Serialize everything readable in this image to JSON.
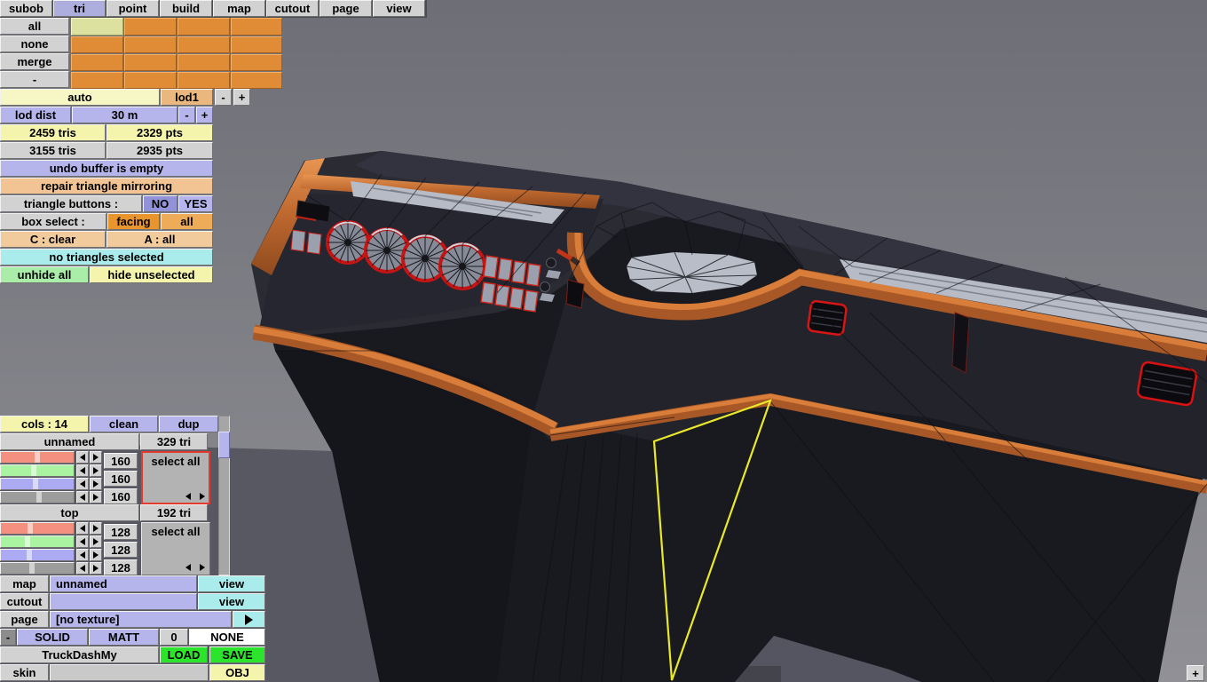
{
  "menu": {
    "tabs": [
      "subob",
      "tri",
      "point",
      "build",
      "map",
      "cutout",
      "page",
      "view"
    ],
    "active_tab": "tri"
  },
  "subob_panel": {
    "buttons": [
      "all",
      "none",
      "merge",
      "-"
    ]
  },
  "lod_bar": {
    "auto": "auto",
    "lod": "lod1",
    "minus": "-",
    "plus": "+"
  },
  "lod_dist": {
    "label": "lod dist",
    "value": "30 m",
    "minus": "-",
    "plus": "+"
  },
  "stats": {
    "lod_tris": "2459 tris",
    "lod_pts": "2329 pts",
    "model_tris": "3155 tris",
    "model_pts": "2935 pts"
  },
  "status": {
    "undo": "undo buffer is empty",
    "repair": "repair triangle mirroring",
    "selection": "no triangles selected"
  },
  "triangle_buttons": {
    "label": "triangle buttons :",
    "no": "NO",
    "yes": "YES"
  },
  "box_select": {
    "label": "box select :",
    "facing": "facing",
    "all": "all"
  },
  "keys": {
    "clear": "C : clear",
    "all": "A : all"
  },
  "visibility": {
    "unhide": "unhide all",
    "hide": "hide unselected"
  },
  "collections": {
    "cols": "cols : 14",
    "clean": "clean",
    "dup": "dup",
    "groups": [
      {
        "name": "unnamed",
        "tris": "329 tri",
        "select": "select all",
        "r": "160",
        "g": "160",
        "b": "160"
      },
      {
        "name": "top",
        "tris": "192 tri",
        "select": "select all",
        "r": "128",
        "g": "128",
        "b": "128"
      }
    ]
  },
  "texture": {
    "map_label": "map",
    "map_name": "unnamed",
    "map_view": "view",
    "cutout_label": "cutout",
    "cutout_view": "view",
    "page_label": "page",
    "page_value": "[no texture]",
    "minus": "-",
    "solid": "SOLID",
    "matt": "MATT",
    "count": "0",
    "none": "NONE"
  },
  "file": {
    "model_name": "TruckDashMy",
    "load": "LOAD",
    "save": "SAVE",
    "skin_label": "skin",
    "obj": "OBJ"
  },
  "viewport": {
    "add_button": "+"
  },
  "colors": {
    "accent_orange": "#e08b36",
    "trim_orange": "#c06a30",
    "highlight_yellow": "#e9e92a",
    "gauge_red": "#c41414",
    "select_red": "#e23a2e",
    "panel_periwinkle": "#b5b5ec",
    "floor_gray": "#585863",
    "body_dark": "#191920"
  }
}
